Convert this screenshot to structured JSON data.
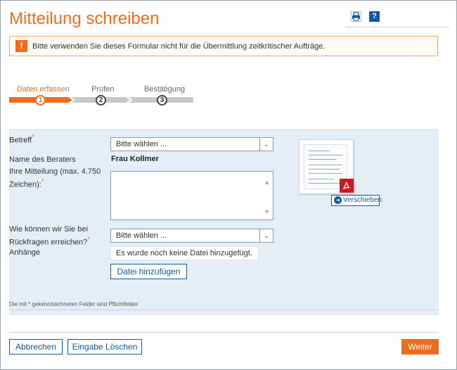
{
  "page": {
    "title": "Mitteilung schreiben"
  },
  "toolbar": {
    "print_icon": "printer-icon",
    "help_icon": "help-icon",
    "help_label": "?"
  },
  "alert": {
    "icon_label": "!",
    "text": "Bitte verwenden Sie dieses Formular nicht für die Übermittlung zeitkritischer Aufträge."
  },
  "steps": [
    {
      "label": "Daten erfassen",
      "number": "1",
      "active": true
    },
    {
      "label": "Prüfen",
      "number": "2",
      "active": false
    },
    {
      "label": "Bestätigung",
      "number": "3",
      "active": false
    }
  ],
  "form": {
    "subject_label": "Betreff",
    "subject_value": "Bitte wählen ...",
    "advisor_label": "Name des Beraters",
    "advisor_value": "Frau Kollmer",
    "message_label_1": "Ihre Mitteilung (max. 4.750",
    "message_label_2": "Zeichen):",
    "message_value": "",
    "contact_label_1": "Wie können wir Sie bei",
    "contact_label_2": "Rückfragen erreichen?",
    "contact_value": "Bitte wählen ...",
    "attachments_label": "Anhänge",
    "attachments_status": "Es wurde noch keine Datei hinzugefügt.",
    "add_file_label": "Datei hinzufügen",
    "required_marker": "*",
    "footnote": "Die mit * gekennzeichneten Felder sind Pflichtfelder."
  },
  "preview": {
    "pdf_label": "PDF",
    "move_label": "Verschieben"
  },
  "footer": {
    "cancel_label": "Abbrechen",
    "clear_label": "Eingabe Löschen",
    "next_label": "Weiter"
  },
  "colors": {
    "accent": "#f26b1d",
    "link": "#0c5aa6",
    "panel": "#e5eef6"
  }
}
